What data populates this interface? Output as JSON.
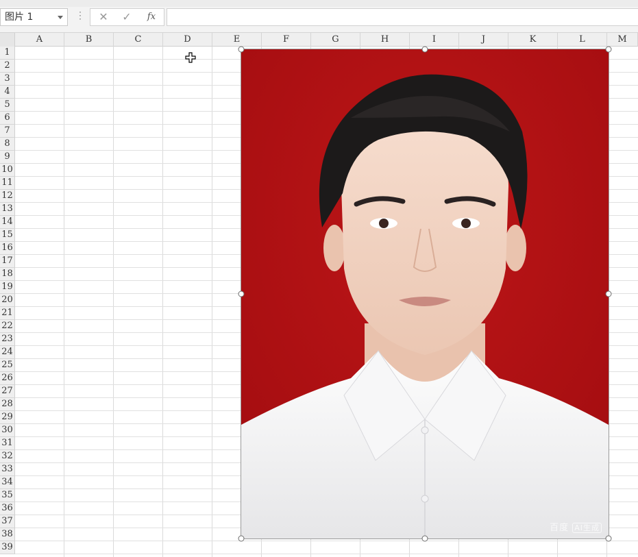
{
  "name_box": {
    "value": "图片 1"
  },
  "formula_bar": {
    "cancel_icon": "x-icon",
    "enter_icon": "check-icon",
    "fx_label": "fx",
    "formula_value": ""
  },
  "columns": [
    "A",
    "B",
    "C",
    "D",
    "E",
    "F",
    "G",
    "H",
    "I",
    "J",
    "K",
    "L",
    "M"
  ],
  "rows": [
    "1",
    "2",
    "3",
    "4",
    "5",
    "6",
    "7",
    "8",
    "9",
    "10",
    "11",
    "12",
    "13",
    "14",
    "15",
    "16",
    "17",
    "18",
    "19",
    "20",
    "21",
    "22",
    "23",
    "24",
    "25",
    "26",
    "27",
    "28",
    "29",
    "30",
    "31",
    "32",
    "33",
    "34",
    "35",
    "36",
    "37",
    "38",
    "39"
  ],
  "picture": {
    "name": "图片 1",
    "background_color": "#b21114",
    "watermark": {
      "brand": "百度",
      "badge": "AI生成"
    }
  },
  "colors": {
    "grid_line": "#dadada",
    "header_bg": "#efefef",
    "photo_bg": "#b21114",
    "shirt": "#f3f3f3"
  }
}
